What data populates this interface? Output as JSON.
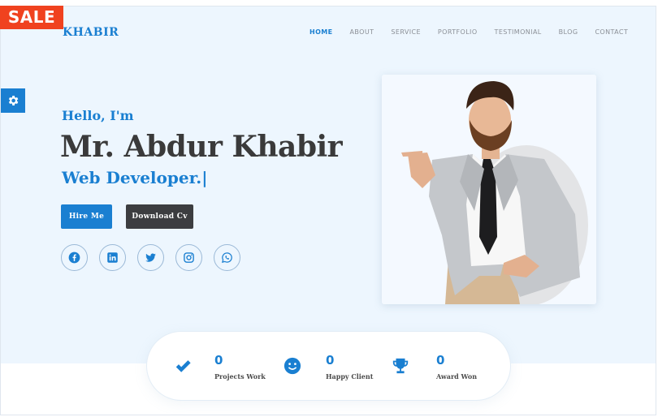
{
  "badge": {
    "label": "SALE"
  },
  "brand": {
    "name": "KHABIR"
  },
  "nav": {
    "items": [
      {
        "label": "HOME",
        "active": true
      },
      {
        "label": "ABOUT"
      },
      {
        "label": "SERVICE"
      },
      {
        "label": "PORTFOLIO"
      },
      {
        "label": "TESTIMONIAL"
      },
      {
        "label": "BLOG"
      },
      {
        "label": "CONTACT"
      }
    ]
  },
  "hero": {
    "greeting": "Hello, I'm",
    "name": "Mr. Abdur Khabir",
    "role": "Web Developer.",
    "caret": "|",
    "hire_label": "Hire Me",
    "cv_label": "Download Cv"
  },
  "socials": [
    {
      "icon": "facebook-icon"
    },
    {
      "icon": "linkedin-icon"
    },
    {
      "icon": "twitter-icon"
    },
    {
      "icon": "instagram-icon"
    },
    {
      "icon": "whatsapp-icon"
    }
  ],
  "stats": [
    {
      "icon": "check-icon",
      "value": "0",
      "label": "Projects Work"
    },
    {
      "icon": "smiley-icon",
      "value": "0",
      "label": "Happy Client"
    },
    {
      "icon": "trophy-icon",
      "value": "0",
      "label": "Award Won"
    }
  ],
  "colors": {
    "accent": "#1a7fd1",
    "sale": "#f0421f",
    "dark_button": "#3c3d40",
    "hero_background": "#edf6fe"
  }
}
